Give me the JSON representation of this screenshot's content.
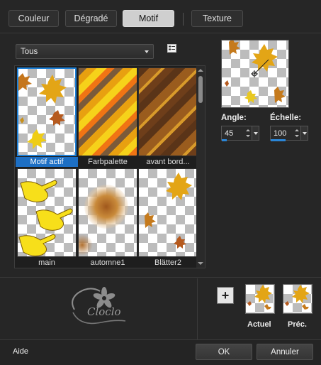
{
  "tabs": [
    {
      "label": "Couleur",
      "active": false
    },
    {
      "label": "Dégradé",
      "active": false
    },
    {
      "label": "Motif",
      "active": true
    },
    {
      "label": "Texture",
      "active": false
    }
  ],
  "category_select": {
    "value": "Tous"
  },
  "patterns": [
    {
      "label": "Motif actif",
      "selected": true
    },
    {
      "label": "Farbpalette",
      "selected": false
    },
    {
      "label": "avant bord...",
      "selected": false
    },
    {
      "label": "main",
      "selected": false
    },
    {
      "label": "automne1",
      "selected": false
    },
    {
      "label": "Blätter2",
      "selected": false
    }
  ],
  "angle": {
    "label": "Angle:",
    "value": "45",
    "level_fraction": 0.125
  },
  "scale": {
    "label": "Échelle:",
    "value": "100",
    "level_fraction": 0.4
  },
  "swatches": {
    "current_label": "Actuel",
    "previous_label": "Préc."
  },
  "logo": {
    "text": "Cloclo"
  },
  "footer": {
    "help": "Aide",
    "ok": "OK",
    "cancel": "Annuler"
  },
  "colors": {
    "accent": "#1d7fd6",
    "background": "#262626",
    "active_tab": "#cfcfcf"
  },
  "icons": [
    "list-view-icon",
    "plus-icon",
    "spin-arrows-icon",
    "dropdown-arrow-icon"
  ]
}
